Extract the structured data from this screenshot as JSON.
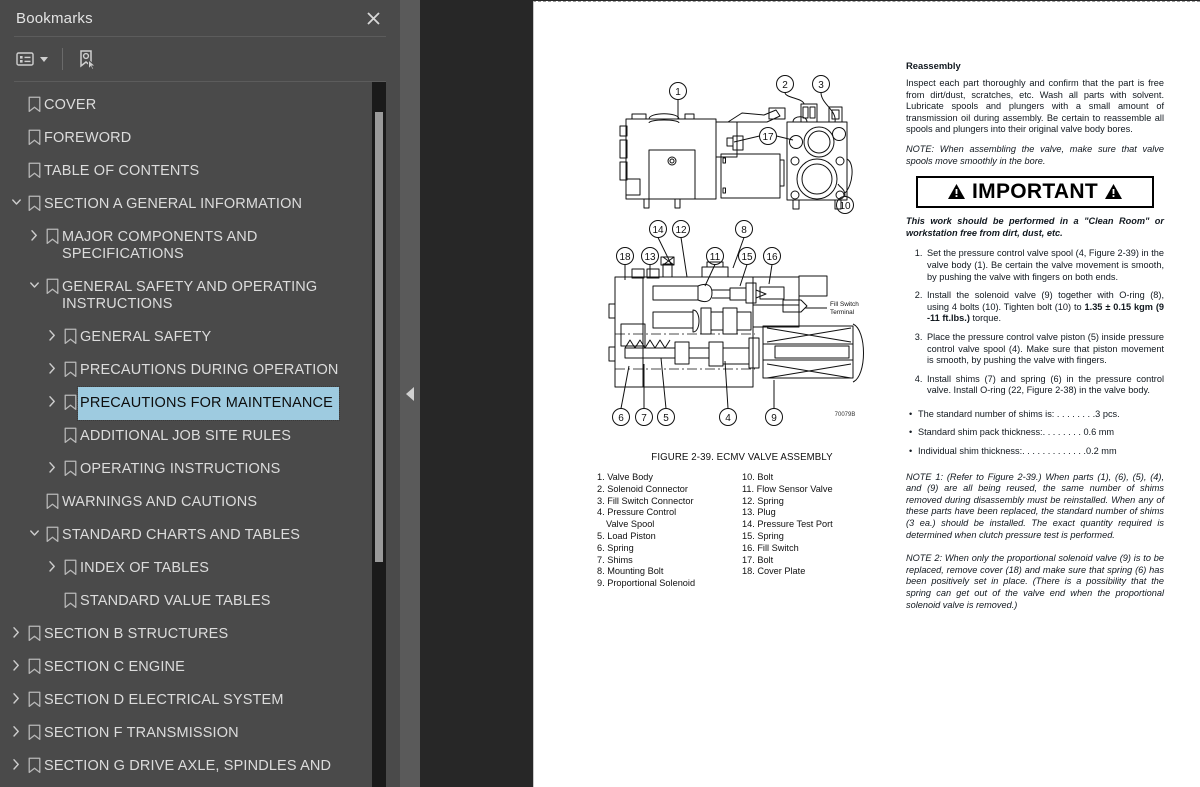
{
  "sidebar": {
    "title": "Bookmarks",
    "close_icon": "close-icon",
    "toolbar": {
      "options_label": "list-options-icon",
      "new_bookmark_label": "new-bookmark-icon"
    },
    "items": [
      {
        "label": "COVER",
        "depth": 0,
        "twisty": "none",
        "selected": false
      },
      {
        "label": "FOREWORD",
        "depth": 0,
        "twisty": "none",
        "selected": false
      },
      {
        "label": "TABLE OF CONTENTS",
        "depth": 0,
        "twisty": "none",
        "selected": false
      },
      {
        "label": "SECTION A GENERAL INFORMATION",
        "depth": 0,
        "twisty": "open",
        "selected": false
      },
      {
        "label": "MAJOR COMPONENTS AND\nSPECIFICATIONS",
        "depth": 1,
        "twisty": "closed",
        "selected": false
      },
      {
        "label": "GENERAL SAFETY AND OPERATING\nINSTRUCTIONS",
        "depth": 1,
        "twisty": "open",
        "selected": false
      },
      {
        "label": "GENERAL SAFETY",
        "depth": 2,
        "twisty": "closed",
        "selected": false
      },
      {
        "label": "PRECAUTIONS DURING OPERATION",
        "depth": 2,
        "twisty": "closed",
        "selected": false
      },
      {
        "label": "PRECAUTIONS FOR MAINTENANCE",
        "depth": 2,
        "twisty": "closed",
        "selected": true
      },
      {
        "label": "ADDITIONAL JOB SITE RULES",
        "depth": 2,
        "twisty": "none",
        "selected": false
      },
      {
        "label": "OPERATING INSTRUCTIONS",
        "depth": 2,
        "twisty": "closed",
        "selected": false
      },
      {
        "label": "WARNINGS AND CAUTIONS",
        "depth": 1,
        "twisty": "none",
        "selected": false
      },
      {
        "label": "STANDARD CHARTS AND TABLES",
        "depth": 1,
        "twisty": "open",
        "selected": false
      },
      {
        "label": "INDEX OF TABLES",
        "depth": 2,
        "twisty": "closed",
        "selected": false
      },
      {
        "label": "STANDARD VALUE TABLES",
        "depth": 2,
        "twisty": "none",
        "selected": false
      },
      {
        "label": "SECTION B STRUCTURES",
        "depth": 0,
        "twisty": "closed",
        "selected": false
      },
      {
        "label": "SECTION C ENGINE",
        "depth": 0,
        "twisty": "closed",
        "selected": false
      },
      {
        "label": "SECTION D ELECTRICAL SYSTEM",
        "depth": 0,
        "twisty": "closed",
        "selected": false
      },
      {
        "label": "SECTION F TRANSMISSION",
        "depth": 0,
        "twisty": "closed",
        "selected": false
      },
      {
        "label": "SECTION G DRIVE AXLE, SPINDLES AND",
        "depth": 0,
        "twisty": "closed",
        "selected": false
      }
    ]
  },
  "colors": {
    "sidebar_bg": "#4a4a4a",
    "viewer_bg": "#272727",
    "selection": "#9ecbe0",
    "text": "#dcdcdc"
  },
  "document": {
    "figure": {
      "caption": "FIGURE 2-39. ECMV VALVE ASSEMBLY",
      "drawing_id": "70079B",
      "inline_label": "Fill Switch\nTerminal",
      "callouts_top": [
        "1",
        "2",
        "3",
        "17",
        "14",
        "12",
        "8",
        "10"
      ],
      "callouts_bottom": [
        "18",
        "13",
        "11",
        "15",
        "16",
        "6",
        "7",
        "5",
        "4",
        "9"
      ],
      "parts_left": [
        "1. Valve Body",
        "2. Solenoid Connector",
        "3. Fill Switch Connector",
        "4. Pressure Control",
        "Valve Spool",
        "5. Load Piston",
        "6. Spring",
        "7. Shims",
        "8. Mounting Bolt",
        "9. Proportional Solenoid"
      ],
      "parts_right": [
        "10. Bolt",
        "11. Flow Sensor Valve",
        "12. Spring",
        "13. Plug",
        "14. Pressure Test Port",
        "15. Spring",
        "16. Fill Switch",
        "17. Bolt",
        "18. Cover Plate"
      ]
    },
    "text_column": {
      "heading": "Reassembly",
      "intro": "Inspect each part thoroughly and confirm that the part is free from dirt/dust, scratches, etc. Wash all parts with solvent. Lubricate spools and plungers with a small amount of transmission oil during assembly. Be certain to reassemble all spools and plungers into their original valve body bores.",
      "note_intro": "NOTE: When assembling the valve, make sure that valve spools move smoothly in the bore.",
      "important_label": "IMPORTANT",
      "clean_room": "This work should be performed in a \"Clean Room\" or workstation free from dirt, dust, etc.",
      "steps": [
        "Set the pressure control valve spool (4, Figure 2-39) in the valve body (1). Be certain the valve movement is smooth, by pushing the valve with fingers on both ends.",
        "Install the solenoid valve (9) together with O-ring (8), using 4 bolts (10). Tighten bolt (10) to 1.35 ± 0.15 kgm (9 -11 ft.lbs.) torque.",
        "Place the pressure control valve piston (5) inside pressure control valve spool (4). Make sure that piston movement is smooth, by pushing the valve with fingers.",
        "Install shims (7) and spring (6) in the pressure control valve. Install O-ring (22, Figure 2-38) in the valve body."
      ],
      "step2_bold": "1.35 ± 0.15 kgm (9 -11 ft.lbs.)",
      "bullets": [
        "The standard number of shims is: . . . . . . . .3 pcs.",
        "Standard shim pack thickness:. . . . . . . .  0.6 mm",
        "Individual shim thickness:. . . . . . . . . . . . .0.2 mm"
      ],
      "note1": "NOTE 1: (Refer to Figure 2-39.) When parts (1), (6), (5), (4), and (9) are all being reused, the same number of shims removed during disassembly must be reinstalled. When any of these parts have been replaced, the standard number of shims (3 ea.) should be installed. The exact quantity required is determined when clutch pressure test is performed.",
      "note2": "NOTE 2: When only the proportional solenoid valve (9) is to be replaced, remove cover (18) and make sure that spring (6) has been positively set in place. (There is a possibility that the spring can get out of the valve end when the proportional solenoid valve is removed.)"
    }
  }
}
